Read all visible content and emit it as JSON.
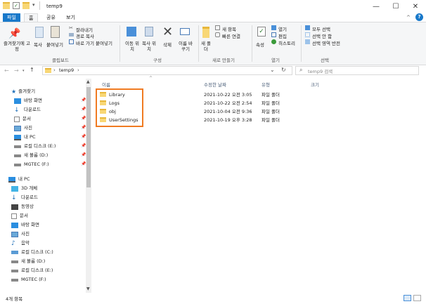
{
  "window": {
    "title": "temp9",
    "minimize": "—",
    "maximize": "☐",
    "close": "✕",
    "help": "?",
    "collapse": "^"
  },
  "ribbon_tabs": [
    "파일",
    "홈",
    "공유",
    "보기"
  ],
  "ribbon": {
    "clipboard": {
      "pin": "즐겨찾기에 고정",
      "copy": "복사",
      "paste": "붙여넣기",
      "cut": "잘라내기",
      "copy_path": "경로 복사",
      "paste_shortcut": "바로 가기 붙여넣기",
      "label": "클립보드"
    },
    "organize": {
      "move_to": "이동 위치",
      "copy_to": "복사 위치",
      "delete": "삭제",
      "rename": "이름 바꾸기",
      "label": "구성"
    },
    "new": {
      "new_folder": "새 폴더",
      "new_item": "새 항목",
      "easy_access": "빠른 연결",
      "label": "새로 만들기"
    },
    "open": {
      "properties": "속성",
      "open": "열기",
      "edit": "편집",
      "history": "히스토리",
      "label": "열기"
    },
    "select": {
      "select_all": "모두 선택",
      "select_none": "선택 안 함",
      "invert": "선택 영역 반전",
      "label": "선택"
    }
  },
  "address": {
    "path_root": "›",
    "path": "temp9",
    "path_sep": "›",
    "search_placeholder": "temp9 검색"
  },
  "nav": {
    "back": "←",
    "forward": "→",
    "up": "↑",
    "dropdown": "⌄",
    "refresh": "↻"
  },
  "sidebar": {
    "quick_access": "즐겨찾기",
    "quick_items": [
      "바탕 화면",
      "다운로드",
      "문서",
      "사진",
      "내 PC",
      "로컬 디스크 (E:)",
      "새 볼륨 (D:)",
      "MGTEC (F:)"
    ],
    "this_pc": "내 PC",
    "pc_items": [
      "3D 개체",
      "다운로드",
      "동영상",
      "문서",
      "바탕 화면",
      "사진",
      "음악",
      "로컬 디스크 (C:)",
      "새 볼륨 (D:)",
      "로컬 디스크 (E:)",
      "MGTEC (F:)"
    ]
  },
  "columns": {
    "name": "이름",
    "modified": "수정한 날짜",
    "type": "유형",
    "size": "크기"
  },
  "files": [
    {
      "name": "Library",
      "modified": "2021-10-22 오전 3:05",
      "type": "파일 폴더"
    },
    {
      "name": "Logs",
      "modified": "2021-10-22 오전 2:54",
      "type": "파일 폴더"
    },
    {
      "name": "obj",
      "modified": "2021-10-04 오전 9:36",
      "type": "파일 폴더"
    },
    {
      "name": "UserSettings",
      "modified": "2021-10-19 오후 3:28",
      "type": "파일 폴더"
    }
  ],
  "status": {
    "count": "4개 항목"
  },
  "colors": {
    "accent": "#1979ca",
    "highlight": "#f07b22",
    "folder": "#f8d775"
  }
}
